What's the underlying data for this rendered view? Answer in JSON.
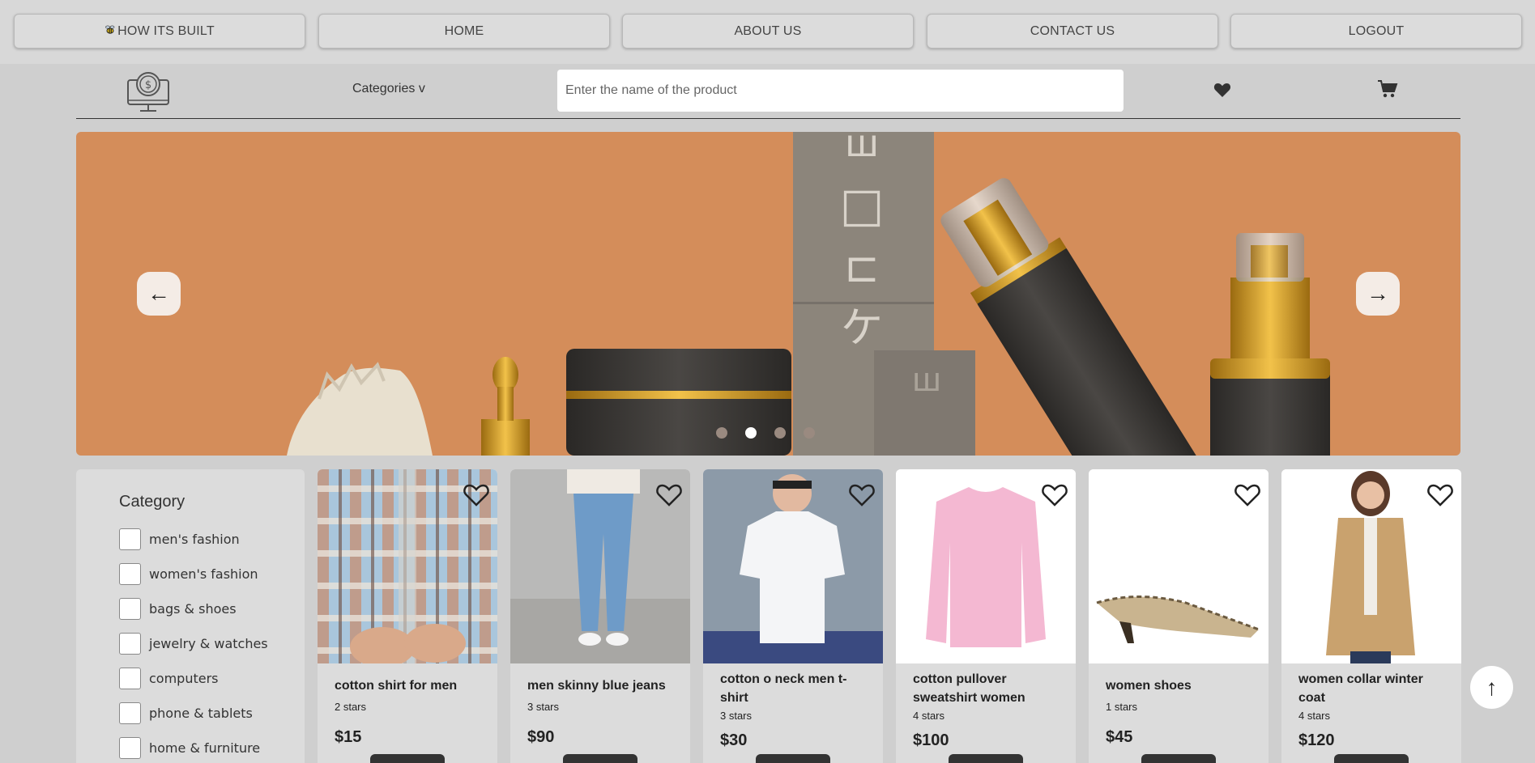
{
  "nav": {
    "how_its_built": "HOW ITS BUILT",
    "home": "HOME",
    "about": "ABOUT US",
    "contact": "CONTACT US",
    "logout": "LOGOUT"
  },
  "header": {
    "categories_label": "Categories v",
    "search_placeholder": "Enter the name of the product"
  },
  "hero": {
    "prev_arrow": "←",
    "next_arrow": "→",
    "slide_count": 4,
    "active_slide": 2,
    "background_color": "#d48d5a"
  },
  "sidebar": {
    "title": "Category",
    "categories": [
      "men's fashion",
      "women's fashion",
      "bags & shoes",
      "jewelry & watches",
      "computers",
      "phone & tablets",
      "home & furniture"
    ]
  },
  "products": [
    {
      "name": "cotton shirt for men",
      "stars": "2 stars",
      "price": "$15"
    },
    {
      "name": "men skinny blue jeans",
      "stars": "3 stars",
      "price": "$90"
    },
    {
      "name": "cotton o neck men t-shirt",
      "stars": "3 stars",
      "price": "$30"
    },
    {
      "name": "cotton pullover sweatshirt women",
      "stars": "4 stars",
      "price": "$100"
    },
    {
      "name": "women shoes",
      "stars": "1 stars",
      "price": "$45"
    },
    {
      "name": "women collar winter coat",
      "stars": "4 stars",
      "price": "$120"
    }
  ],
  "back_to_top": "↑",
  "icons": {
    "bee": "bee-icon",
    "logo": "computer-dollar-logo",
    "wishlist": "heart-icon",
    "cart": "cart-icon"
  }
}
